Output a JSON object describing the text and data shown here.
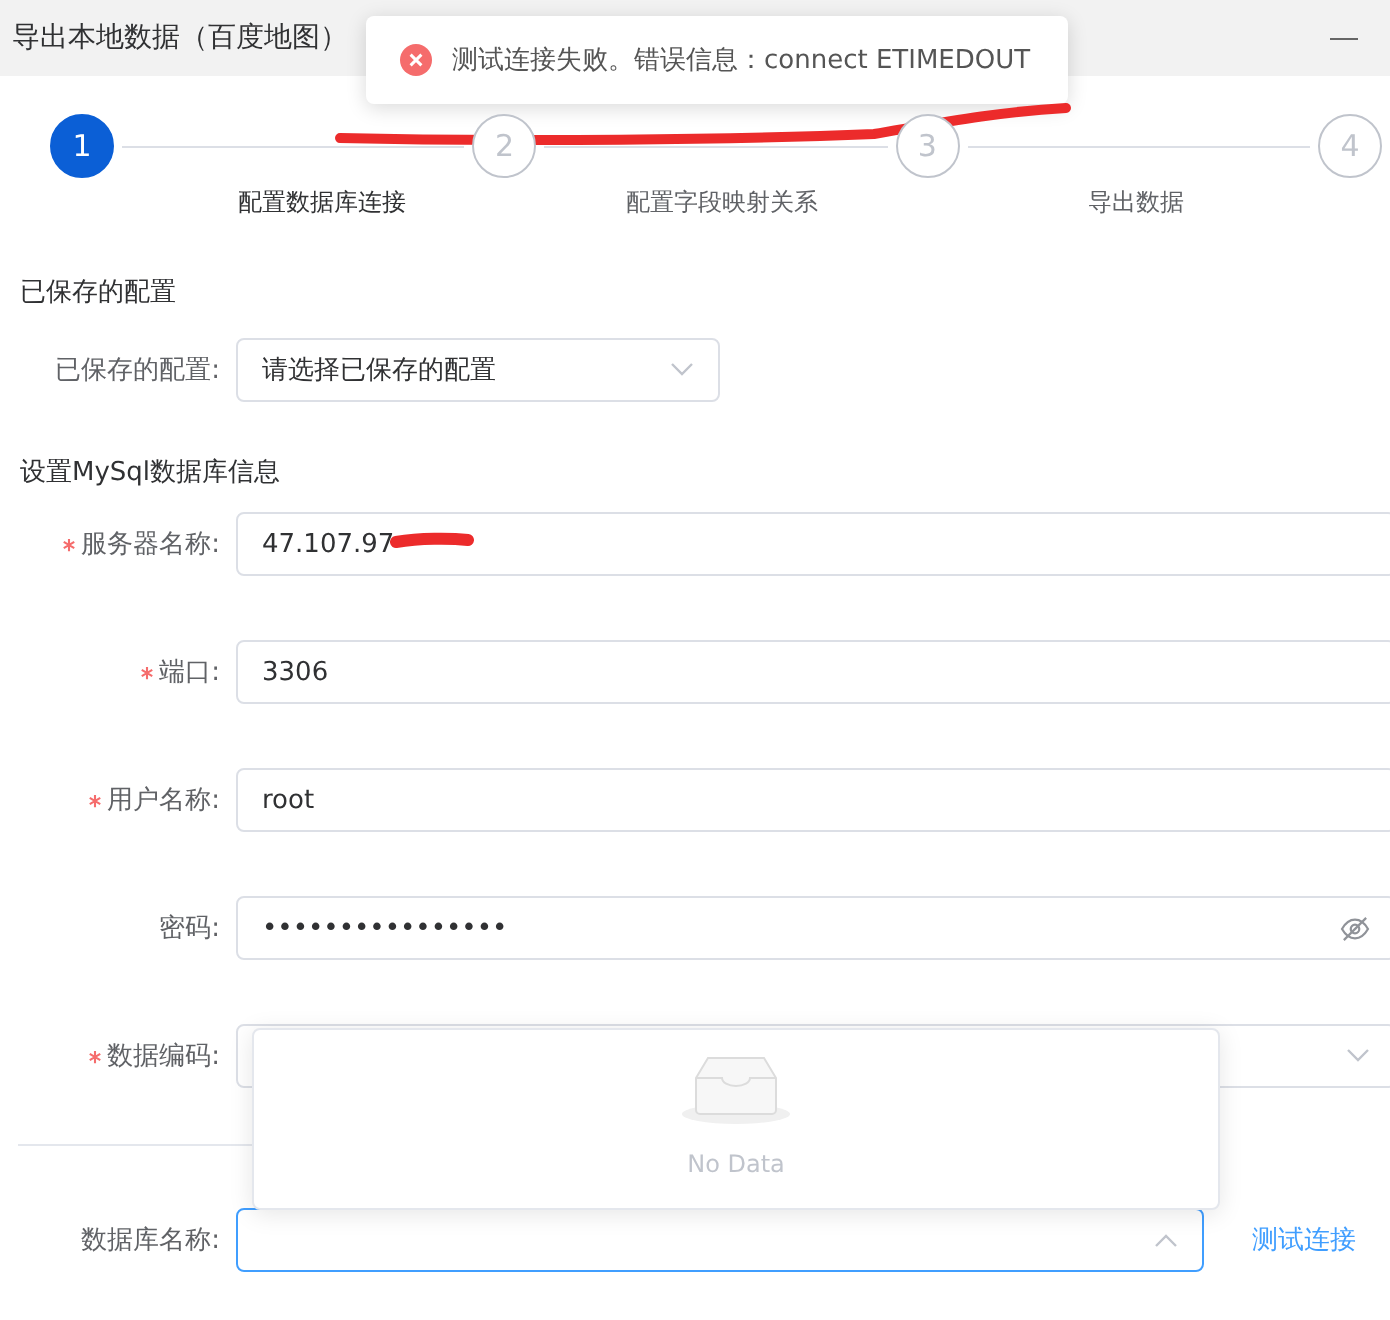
{
  "window": {
    "title": "导出本地数据（百度地图）"
  },
  "toast": {
    "kind": "error",
    "message": "测试连接失败。错误信息：connect ETIMEDOUT"
  },
  "steps": [
    {
      "number": "1",
      "label": "配置数据库连接",
      "selected": true
    },
    {
      "number": "2",
      "label": "配置字段映射关系",
      "selected": false
    },
    {
      "number": "3",
      "label": "导出数据",
      "selected": false
    },
    {
      "number": "4",
      "selected": false
    }
  ],
  "saved_section": {
    "heading": "已保存的配置",
    "field": {
      "label": "已保存的配置:",
      "placeholder": "请选择已保存的配置"
    }
  },
  "mysql_section": {
    "heading": "设置MySql数据库信息",
    "fields": [
      {
        "kind": "text",
        "label": "服务器名称:",
        "value": "47.107.97",
        "required": true
      },
      {
        "kind": "text",
        "label": "端口:",
        "value": "3306",
        "required": true
      },
      {
        "kind": "text",
        "label": "用户名称:",
        "value": "root",
        "required": true
      },
      {
        "kind": "password",
        "label": "密码:",
        "value": "••••••••••••••••",
        "required": false
      },
      {
        "kind": "select",
        "label": "数据编码:",
        "required": true
      }
    ]
  },
  "dropdown": {
    "empty_text": "No Data"
  },
  "database_field": {
    "label": "数据库名称:",
    "focused": true
  },
  "test_link": {
    "label": "测试连接"
  }
}
